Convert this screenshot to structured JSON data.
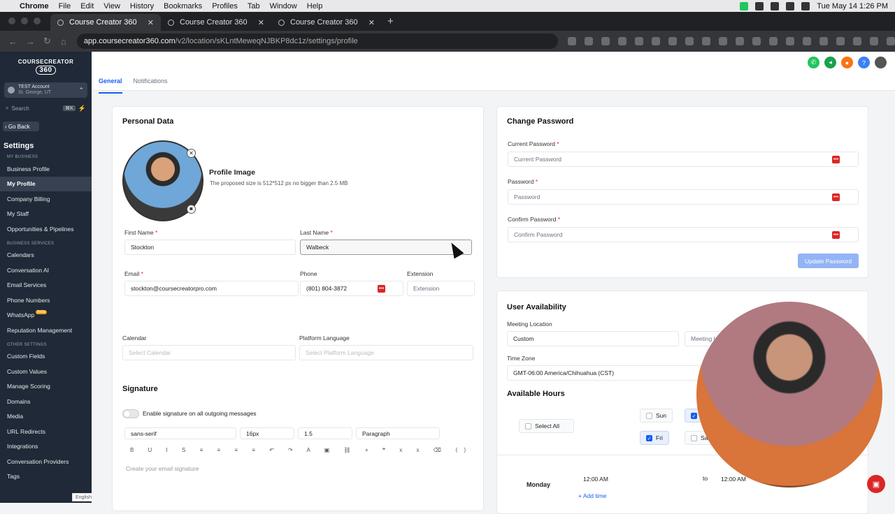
{
  "macbar": {
    "app": "Chrome",
    "menus": [
      "File",
      "Edit",
      "View",
      "History",
      "Bookmarks",
      "Profiles",
      "Tab",
      "Window",
      "Help"
    ],
    "clock": "Tue May 14  1:26 PM"
  },
  "browser": {
    "tabs": [
      "Course Creator 360",
      "Course Creator 360",
      "Course Creator 360"
    ],
    "url_host": "app.coursecreator360.com",
    "url_path": "/v2/location/sKLntMeweqNJBKP8dc1z/settings/profile"
  },
  "sidebar": {
    "logo_top": "COURSECREATOR",
    "logo_bottom": "360",
    "account_name": "TEST Account",
    "account_loc": "St. George, UT",
    "search_placeholder": "Search",
    "search_kbd": "⌘K",
    "back": "Go Back",
    "settings": "Settings",
    "sections": {
      "my_business": "MY BUSINESS",
      "business_services": "BUSINESS SERVICES",
      "other_settings": "OTHER SETTINGS"
    },
    "items1": [
      "Business Profile",
      "My Profile",
      "Company Billing",
      "My Staff",
      "Opportunities & Pipelines"
    ],
    "items2": [
      "Calendars",
      "Conversation AI",
      "Email Services",
      "Phone Numbers",
      "WhatsApp",
      "Reputation Management"
    ],
    "beta": "beta",
    "items3": [
      "Custom Fields",
      "Custom Values",
      "Manage Scoring",
      "Domains",
      "Media",
      "URL Redirects",
      "Integrations",
      "Conversation Providers",
      "Tags"
    ],
    "lang": "English"
  },
  "tabs": {
    "general": "General",
    "notifications": "Notifications"
  },
  "personal": {
    "title": "Personal Data",
    "profile_image": "Profile Image",
    "profile_hint": "The proposed size is 512*512 px no bigger than 2.5 MB",
    "first_name_label": "First Name",
    "first_name": "Stockton",
    "last_name_label": "Last Name",
    "last_name": "Walbeck",
    "email_label": "Email",
    "email": "stockton@coursecreatorpro.com",
    "phone_label": "Phone",
    "phone": "(801) 804-3872",
    "ext_label": "Extension",
    "ext_placeholder": "Extension",
    "calendar_label": "Calendar",
    "calendar_placeholder": "Select Calendar",
    "language_label": "Platform Language",
    "language_placeholder": "Select Platform Language",
    "signature_title": "Signature",
    "signature_toggle": "Enable signature on all outgoing messages",
    "font": "sans-serif",
    "size": "16px",
    "line": "1.5",
    "block": "Paragraph",
    "signature_placeholder": "Create your email signature"
  },
  "password": {
    "title": "Change Password",
    "current_label": "Current Password",
    "current_ph": "Current Password",
    "new_label": "Password",
    "new_ph": "Password",
    "confirm_label": "Confirm Password",
    "confirm_ph": "Confirm Password",
    "button": "Update Password"
  },
  "availability": {
    "title": "User Availability",
    "meeting_label": "Meeting Location",
    "meeting_value": "Custom",
    "meeting_second": "Meeting L",
    "tz_label": "Time Zone",
    "tz_value": "GMT-06:00 America/Chihuahua (CST)",
    "hours_title": "Available Hours",
    "select_all": "Select All",
    "days_row1": [
      "Sun"
    ],
    "days_row2": [
      "Fri",
      "Sa"
    ],
    "day": "Monday",
    "from": "12:00 AM",
    "to_word": "to",
    "to": "12:00 AM",
    "add_time": "+ Add time"
  }
}
